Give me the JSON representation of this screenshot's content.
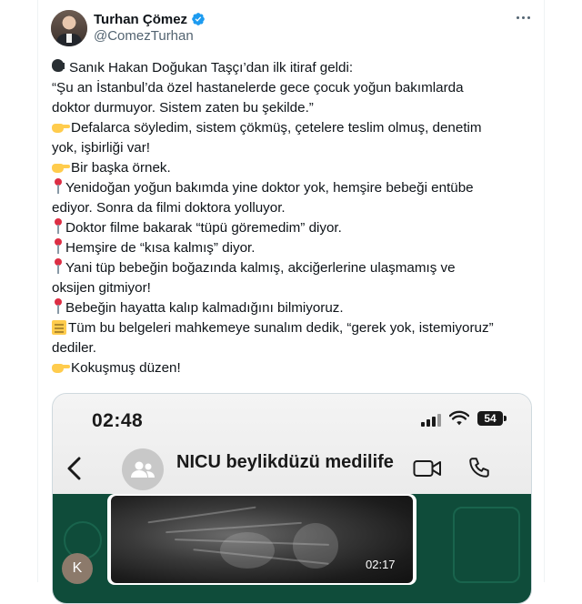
{
  "author": {
    "name": "Turhan Çömez",
    "handle": "@ComezTurhan",
    "verified_color": "#1d9bf0"
  },
  "more_icon": "ellipsis-icon",
  "tweet": {
    "lines": [
      {
        "emoji": "speaking-head-icon",
        "text": "Sanık Hakan Doğukan Taşçı’dan ilk itiraf geldi:"
      },
      {
        "emoji": "",
        "text": "“Şu an İstanbul’da özel hastanelerde gece çocuk yoğun bakımlarda"
      },
      {
        "emoji": "",
        "text": "doktor durmuyor. Sistem zaten bu şekilde.”"
      },
      {
        "emoji": "pointing-hand-icon",
        "text": "Defalarca söyledim, sistem çökmüş, çetelere teslim olmuş, denetim"
      },
      {
        "emoji": "",
        "text": "yok, işbirliği var!"
      },
      {
        "emoji": "pointing-hand-icon",
        "text": "Bir başka örnek."
      },
      {
        "emoji": "pushpin-icon",
        "text": "Yenidoğan yoğun bakımda yine doktor yok, hemşire bebeği entübe"
      },
      {
        "emoji": "",
        "text": "ediyor. Sonra da filmi doktora yolluyor."
      },
      {
        "emoji": "pushpin-icon",
        "text": "Doktor filme bakarak “tüpü göremedim” diyor."
      },
      {
        "emoji": "pushpin-icon",
        "text": "Hemşire de “kısa kalmış” diyor."
      },
      {
        "emoji": "pushpin-icon",
        "text": "Yani tüp bebeğin boğazında kalmış, akciğerlerine ulaşmamış ve"
      },
      {
        "emoji": "",
        "text": "oksijen gitmiyor!"
      },
      {
        "emoji": "pushpin-icon",
        "text": "Bebeğin hayatta kalıp kalmadığını bilmiyoruz."
      },
      {
        "emoji": "scroll-icon",
        "text": "Tüm bu belgeleri mahkemeye sunalım dedik, “gerek yok, istemiyoruz”"
      },
      {
        "emoji": "",
        "text": "dediler."
      },
      {
        "emoji": "pointing-hand-icon",
        "text": "Kokuşmuş düzen!"
      }
    ]
  },
  "media": {
    "status_time": "02:48",
    "battery": "54",
    "chat_title": "NICU beylikdüzü medilife",
    "video_duration": "02:17",
    "sender_initial": "K",
    "icons": {
      "back": "back-chevron-icon",
      "group": "group-avatar-icon",
      "video": "video-call-icon",
      "call": "phone-call-icon",
      "signal": "signal-icon",
      "wifi": "wifi-icon"
    },
    "colors": {
      "chat_background": "#0f4c3a"
    }
  }
}
